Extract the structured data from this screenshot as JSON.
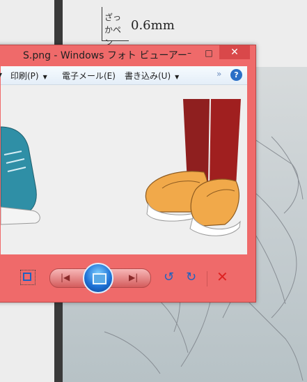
{
  "background": {
    "note_text": "ざっかペン",
    "note_size": "0.6mm"
  },
  "window": {
    "title": "S.png - Windows フォト ビューアー",
    "controls": {
      "minimize": "–",
      "maximize": "□",
      "close": "✕"
    },
    "menu": [
      {
        "label": "印刷(P)"
      },
      {
        "label": "電子メール(E)"
      },
      {
        "label": "書き込み(U)"
      }
    ],
    "help": "?",
    "more": "»"
  },
  "toolbar": {
    "prev_icon": "prev-icon",
    "next_icon": "next-icon",
    "play_icon": "slideshow-icon",
    "rotate_left_icon": "rotate-left-icon",
    "rotate_right_icon": "rotate-right-icon",
    "delete_icon": "delete-icon",
    "rotate_left": "↺",
    "rotate_right": "↻",
    "delete": "✕",
    "prev": "|◀",
    "next": "▶|"
  },
  "colors": {
    "frame": "#ef6a6a",
    "menubar": "#eef5fc",
    "accent": "#1e62c0"
  }
}
